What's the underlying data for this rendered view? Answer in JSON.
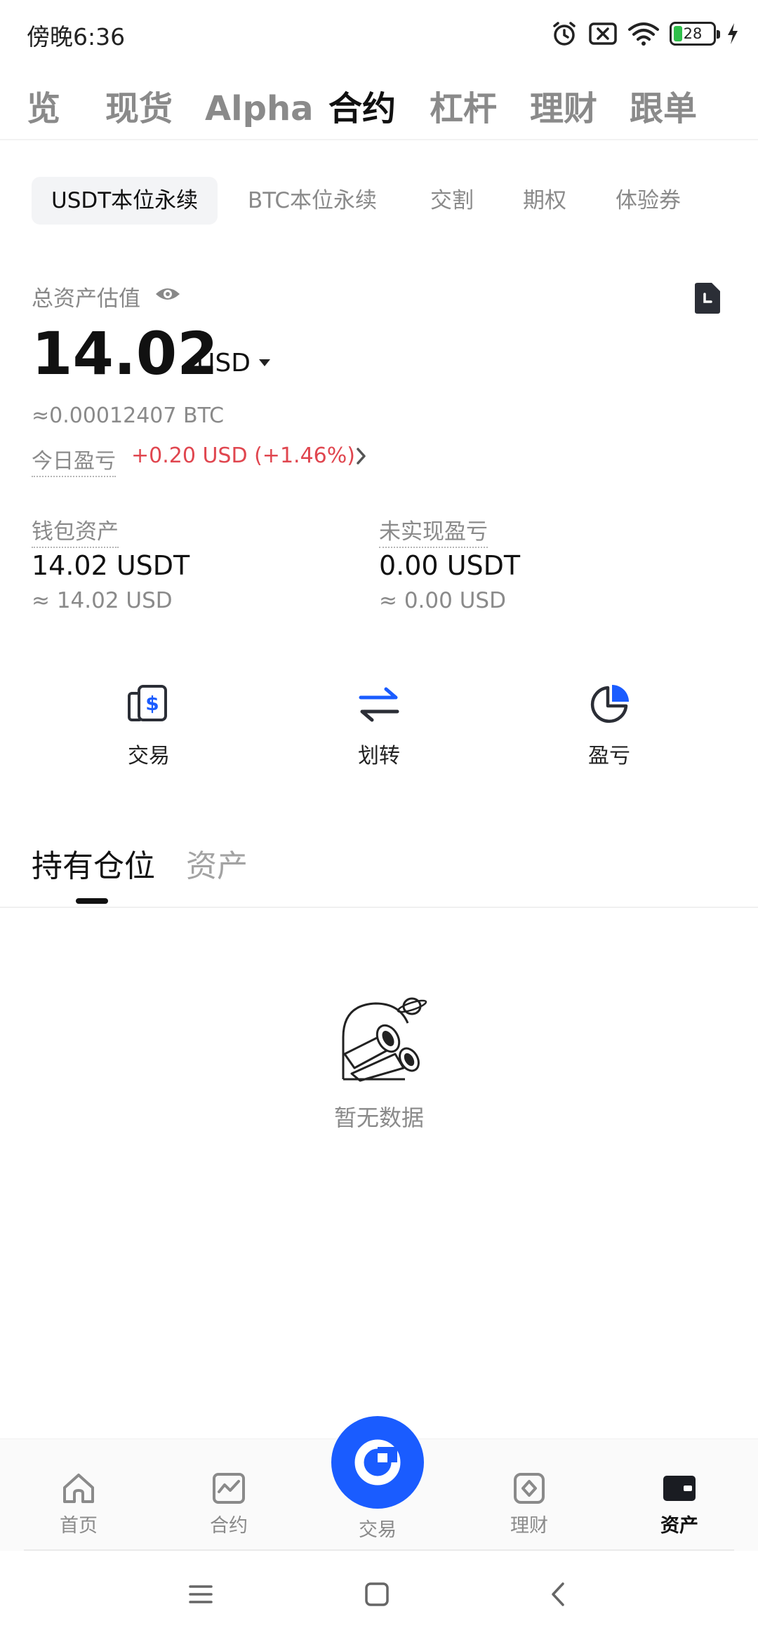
{
  "status": {
    "time": "傍晚6:36",
    "battery": "28"
  },
  "top_tabs": [
    {
      "label": "览"
    },
    {
      "label": "现货"
    },
    {
      "label": "Alpha"
    },
    {
      "label": "合约"
    },
    {
      "label": "杠杆"
    },
    {
      "label": "理财"
    },
    {
      "label": "跟单"
    }
  ],
  "top_tab_active": "合约",
  "sub_tabs": [
    {
      "label": "USDT本位永续"
    },
    {
      "label": "BTC本位永续"
    },
    {
      "label": "交割"
    },
    {
      "label": "期权"
    },
    {
      "label": "体验券"
    }
  ],
  "account": {
    "total_label": "总资产估值",
    "total_value": "14.02",
    "total_unit": "USD",
    "btc_equiv": "≈0.00012407 BTC",
    "today_pnl_label": "今日盈亏",
    "today_pnl_value": "+0.20 USD (+1.46%)"
  },
  "stats": {
    "wallet": {
      "label": "钱包资产",
      "value": "14.02 USDT",
      "sub": "≈ 14.02 USD"
    },
    "unrealized": {
      "label": "未实现盈亏",
      "value": "0.00 USDT",
      "sub": "≈ 0.00 USD"
    }
  },
  "actions": [
    {
      "label": "交易",
      "icon": "trade-icon"
    },
    {
      "label": "划转",
      "icon": "transfer-icon"
    },
    {
      "label": "盈亏",
      "icon": "pie-chart-icon"
    }
  ],
  "holdings": {
    "tabs": [
      {
        "label": "持有仓位"
      },
      {
        "label": "资产"
      }
    ],
    "empty_text": "暂无数据"
  },
  "bottom_nav": [
    {
      "label": "首页",
      "icon": "home-icon"
    },
    {
      "label": "合约",
      "icon": "contract-icon"
    },
    {
      "label": "交易",
      "icon": "trade-fab-icon"
    },
    {
      "label": "理财",
      "icon": "finance-icon"
    },
    {
      "label": "资产",
      "icon": "wallet-icon"
    }
  ],
  "colors": {
    "accent": "#1a5cff",
    "gain": "#e0464f",
    "text": "#111111",
    "muted": "#8a8a8a"
  }
}
